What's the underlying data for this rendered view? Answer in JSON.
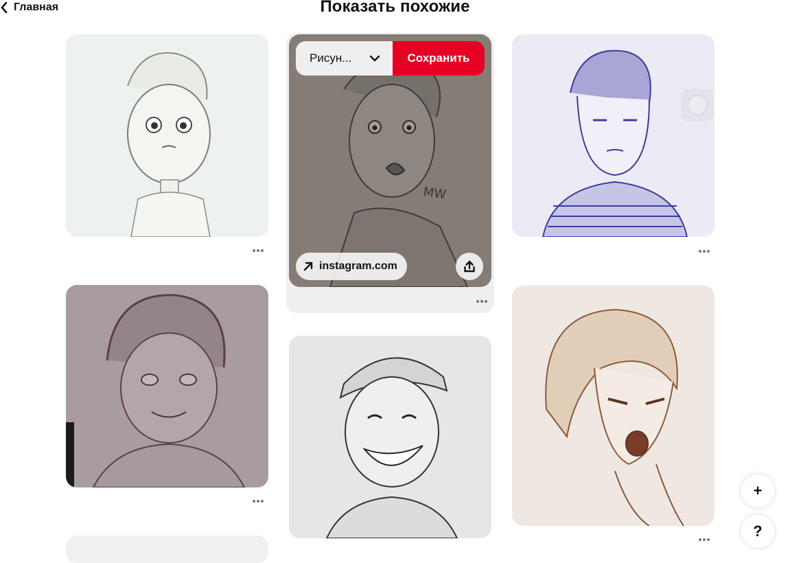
{
  "nav": {
    "back_label": "Главная"
  },
  "header": {
    "title": "Показать похожие"
  },
  "hover_pin": {
    "board_select_value": "Рисун...",
    "save_label": "Сохранить",
    "source_domain": "instagram.com"
  },
  "pins": [
    {
      "column": 1,
      "subject": "boy-sketch-pencil"
    },
    {
      "column": 2,
      "subject": "man-surprised-sketch"
    },
    {
      "column": 3,
      "subject": "man-blue-pen-sketch"
    },
    {
      "column": 1,
      "subject": "curly-boy-sketch"
    },
    {
      "column": 2,
      "subject": "cap-guy-laughing-sketch"
    },
    {
      "column": 3,
      "subject": "angry-girl-sepia-sketch"
    },
    {
      "column": 1,
      "subject": "partial-pin"
    }
  ],
  "floating": {
    "add_label": "+",
    "help_label": "?"
  },
  "colors": {
    "accent_red": "#e60023",
    "hover_bg": "#efefef",
    "dots": "#767676"
  }
}
